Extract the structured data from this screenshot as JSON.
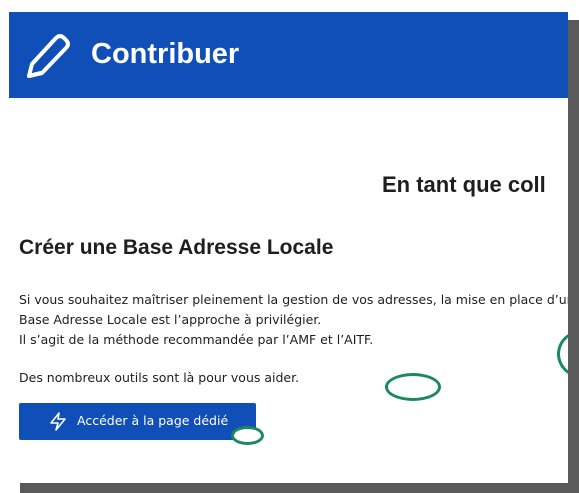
{
  "header": {
    "title": "Contribuer",
    "icon": "pencil-icon",
    "background": "#0f4fb7"
  },
  "main": {
    "subheading": "En tant que coll",
    "section_title": "Créer une Base Adresse Locale",
    "paragraph_lines": [
      "Si vous souhaitez maîtriser pleinement la gestion de vos adresses, la mise en place d’une",
      "Base Adresse Locale est l’approche à privilégier.",
      "Il s’agit de la méthode recommandée par l’AMF et l’AITF."
    ],
    "help_text": "Des nombreux outils sont là pour vous aider.",
    "cta": {
      "label": "Accéder à la page dédié",
      "icon": "lightning-icon"
    }
  },
  "colors": {
    "accent": "#0f4fb7",
    "marker": "#1a8a5e",
    "text": "#1e1e1e"
  }
}
